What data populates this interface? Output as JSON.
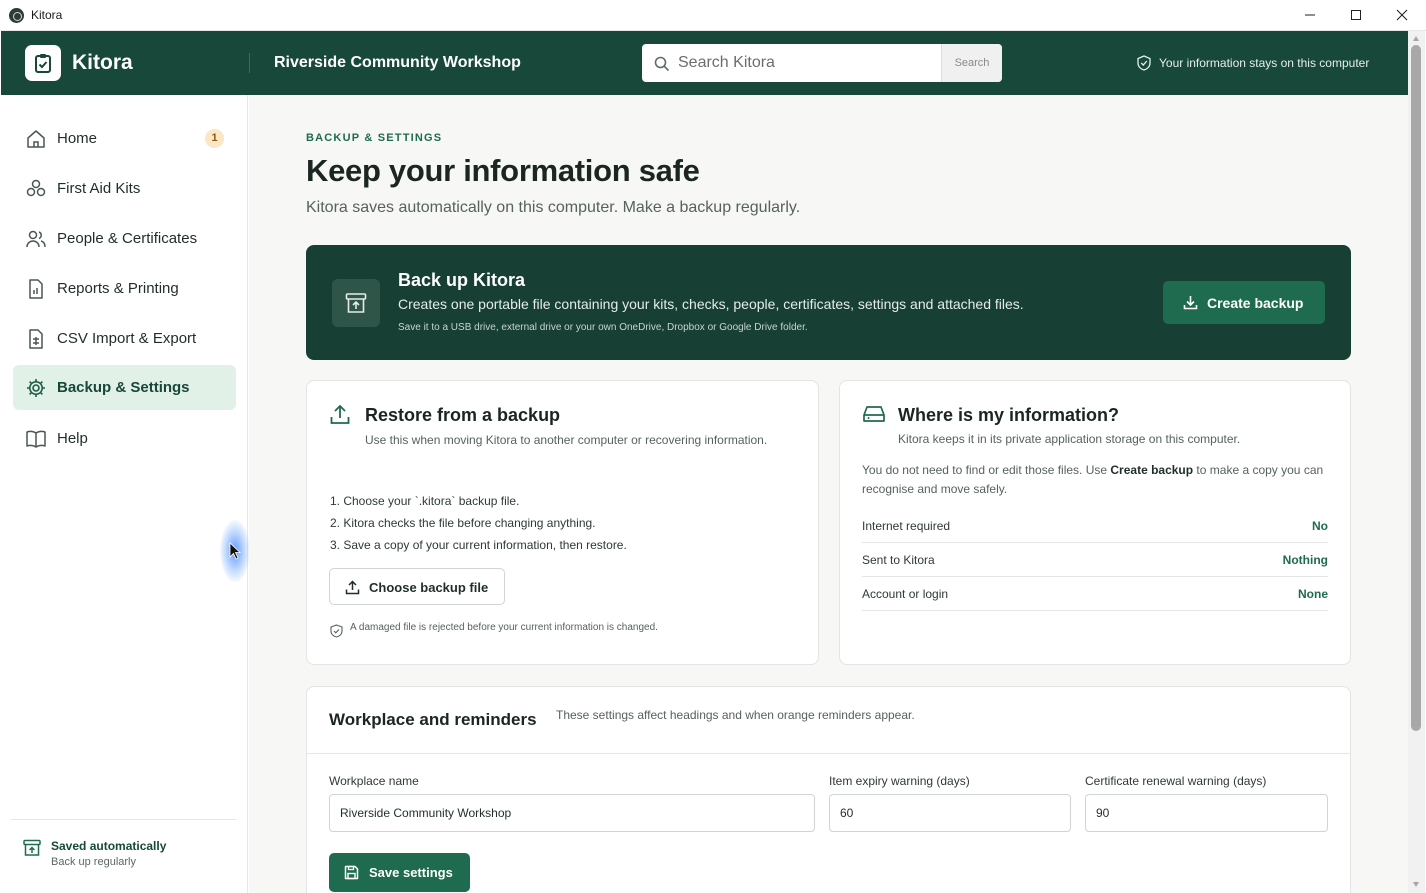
{
  "window": {
    "title": "Kitora"
  },
  "header": {
    "brand": "Kitora",
    "workplace": "Riverside Community Workshop",
    "search_placeholder": "Search Kitora",
    "search_button": "Search",
    "privacy_note": "Your information stays on this computer"
  },
  "sidebar": {
    "items": [
      {
        "label": "Home",
        "icon": "home-icon",
        "badge": "1"
      },
      {
        "label": "First Aid Kits",
        "icon": "kits-icon"
      },
      {
        "label": "People & Certificates",
        "icon": "people-icon"
      },
      {
        "label": "Reports & Printing",
        "icon": "report-icon"
      },
      {
        "label": "CSV Import & Export",
        "icon": "csv-icon"
      },
      {
        "label": "Backup & Settings",
        "icon": "gear-icon",
        "active": true
      },
      {
        "label": "Help",
        "icon": "book-icon"
      }
    ],
    "footer": {
      "title": "Saved automatically",
      "subtitle": "Back up regularly"
    }
  },
  "page": {
    "eyebrow": "BACKUP & SETTINGS",
    "title": "Keep your information safe",
    "subtitle": "Kitora saves automatically on this computer. Make a backup regularly."
  },
  "backup": {
    "title": "Back up Kitora",
    "description": "Creates one portable file containing your kits, checks, people, certificates, settings and attached files.",
    "note": "Save it to a USB drive, external drive or your own OneDrive, Dropbox or Google Drive folder.",
    "button": "Create backup"
  },
  "restore": {
    "title": "Restore from a backup",
    "subtitle": "Use this when moving Kitora to another computer or recovering information.",
    "steps": [
      "1. Choose your `.kitora` backup file.",
      "2. Kitora checks the file before changing anything.",
      "3. Save a copy of your current information, then restore."
    ],
    "button": "Choose backup file",
    "note": "A damaged file is rejected before your current information is changed."
  },
  "where": {
    "title": "Where is my information?",
    "subtitle": "Kitora keeps it in its private application storage on this computer.",
    "desc_before": "You do not need to find or edit those files. Use ",
    "desc_bold": "Create backup",
    "desc_after": " to make a copy you can recognise and move safely.",
    "rows": [
      {
        "key": "Internet required",
        "value": "No"
      },
      {
        "key": "Sent to Kitora",
        "value": "Nothing"
      },
      {
        "key": "Account or login",
        "value": "None"
      }
    ]
  },
  "settings": {
    "title": "Workplace and reminders",
    "subtitle": "These settings affect headings and when orange reminders appear.",
    "fields": {
      "workplace_label": "Workplace name",
      "workplace_value": "Riverside Community Workshop",
      "expiry_label": "Item expiry warning (days)",
      "expiry_value": "60",
      "renewal_label": "Certificate renewal warning (days)",
      "renewal_value": "90"
    },
    "save_button": "Save settings"
  },
  "colors": {
    "brand": "#17483a",
    "accent": "#1f6b4f",
    "badge": "#fbe6c6",
    "active_nav": "#e2f1e8"
  }
}
